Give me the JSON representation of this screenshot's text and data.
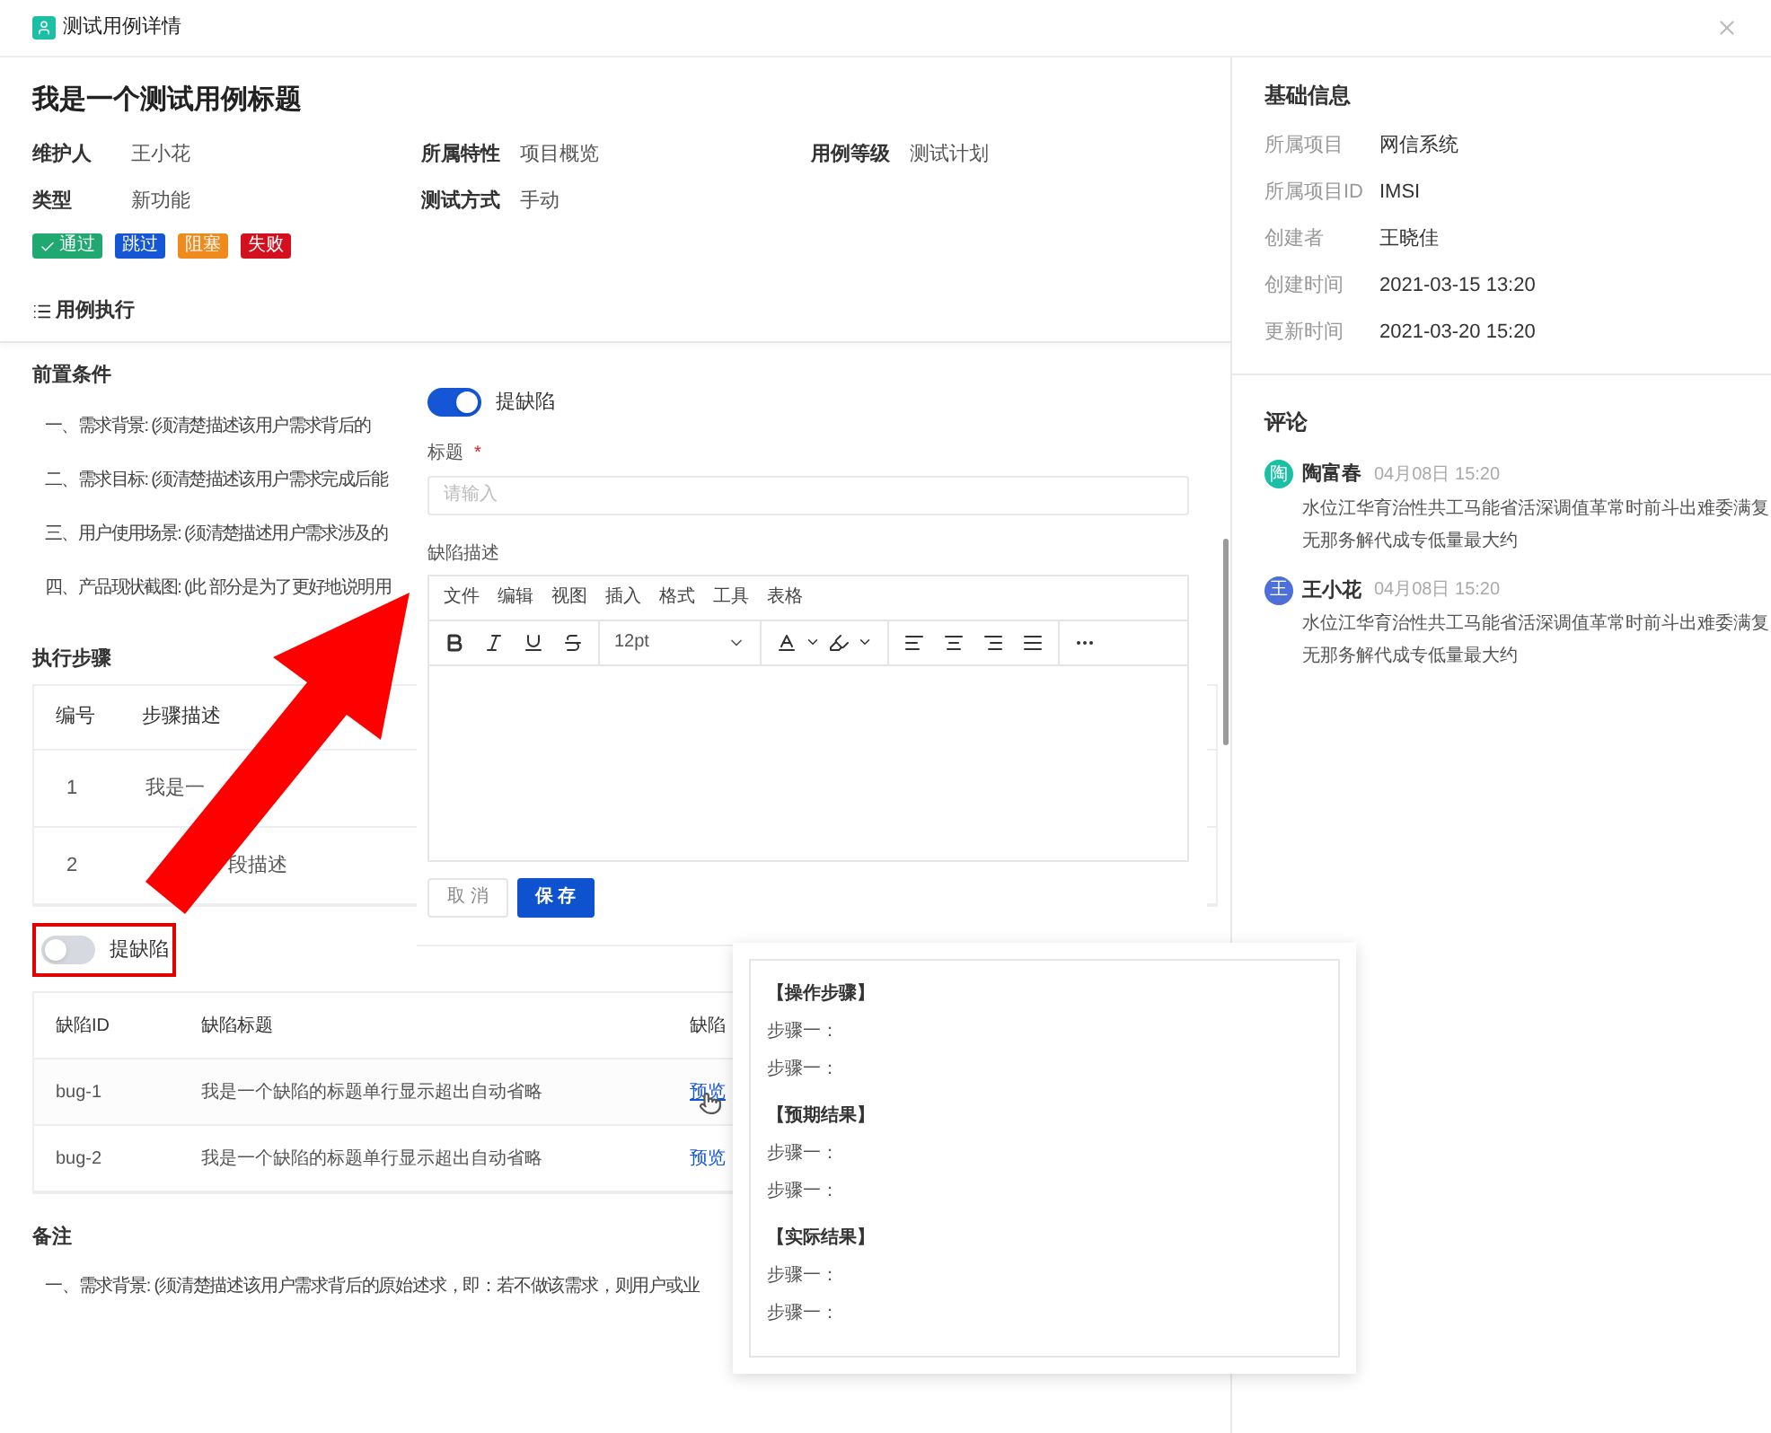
{
  "dialog": {
    "title": "测试用例详情"
  },
  "case": {
    "title": "我是一个测试用例标题",
    "fields": [
      {
        "label": "维护人",
        "value": "王小花"
      },
      {
        "label": "所属特性",
        "value": "项目概览"
      },
      {
        "label": "用例等级",
        "value": "测试计划"
      },
      {
        "label": "类型",
        "value": "新功能"
      },
      {
        "label": "测试方式",
        "value": "手动"
      }
    ],
    "statuses": [
      {
        "label": "通过",
        "color": "#1fa971",
        "selected": true
      },
      {
        "label": "跳过",
        "color": "#1456d6",
        "selected": false
      },
      {
        "label": "阻塞",
        "color": "#f08a1c",
        "selected": false
      },
      {
        "label": "失败",
        "color": "#d4101e",
        "selected": false
      }
    ],
    "section_tab": "用例执行"
  },
  "preconditions": {
    "heading": "前置条件",
    "items": [
      "一、需求背景: (须清楚描述该用户需求背后的",
      "二、需求目标: (须清楚描述该用户需求完成后能",
      "三、用户使用场景: (须清楚描述用户需求涉及的",
      "四、产品现状截图: (此 部分是为了更好地说明用"
    ]
  },
  "steps": {
    "heading": "执行步骤",
    "columns": [
      "编号",
      "步骤描述"
    ],
    "rows": [
      [
        "1",
        "我是一"
      ],
      [
        "2",
        "段描述"
      ]
    ]
  },
  "defect_switch": {
    "label": "提缺陷",
    "on": false
  },
  "defects": {
    "columns": [
      "缺陷ID",
      "缺陷标题",
      "缺陷"
    ],
    "rows": [
      {
        "id": "bug-1",
        "title": "我是一个缺陷的标题单行显示超出自动省略",
        "link": "预览",
        "hovered": true
      },
      {
        "id": "bug-2",
        "title": "我是一个缺陷的标题单行显示超出自动省略",
        "link": "预览",
        "hovered": false
      }
    ]
  },
  "notes": {
    "heading": "备注",
    "text": "一、需求背景: (须清楚描述该用户需求背后的原始述求，即：若不做该需求，则用户或业"
  },
  "basic_info": {
    "heading": "基础信息",
    "rows": [
      {
        "label": "所属项目",
        "value": "网信系统"
      },
      {
        "label": "所属项目ID",
        "value": "IMSI"
      },
      {
        "label": "创建者",
        "value": "王晓佳"
      },
      {
        "label": "创建时间",
        "value": "2021-03-15 13:20"
      },
      {
        "label": "更新时间",
        "value": "2021-03-20 15:20"
      }
    ]
  },
  "comments": {
    "heading": "评论",
    "items": [
      {
        "avatar": "陶",
        "color": "#1bbfa4",
        "name": "陶富春",
        "time": "04月08日 15:20",
        "text": "水位江华育治性共工马能省活深调值革常时前斗出难委满复无那务解代成专低量最大约"
      },
      {
        "avatar": "王",
        "color": "#4d6fd9",
        "name": "王小花",
        "time": "04月08日 15:20",
        "text": "水位江华育治性共工马能省活深调值革常时前斗出难委满复无那务解代成专低量最大约"
      }
    ]
  },
  "defect_form": {
    "switch": {
      "label": "提缺陷",
      "on": true
    },
    "title_label": "标题",
    "required_mark": "*",
    "placeholder": "请输入",
    "desc_label": "缺陷描述",
    "menu": [
      "文件",
      "编辑",
      "视图",
      "插入",
      "格式",
      "工具",
      "表格"
    ],
    "font_size": "12pt",
    "buttons": [
      {
        "label": "取 消",
        "kind": "secondary"
      },
      {
        "label": "保 存",
        "kind": "primary"
      }
    ]
  },
  "preview_popover": {
    "sections": [
      {
        "heading": "【操作步骤】",
        "lines": [
          "步骤一：",
          "步骤一："
        ]
      },
      {
        "heading": "【预期结果】",
        "lines": [
          "步骤一：",
          "步骤一："
        ]
      },
      {
        "heading": "【实际结果】",
        "lines": [
          "步骤一：",
          "步骤一："
        ]
      }
    ]
  }
}
